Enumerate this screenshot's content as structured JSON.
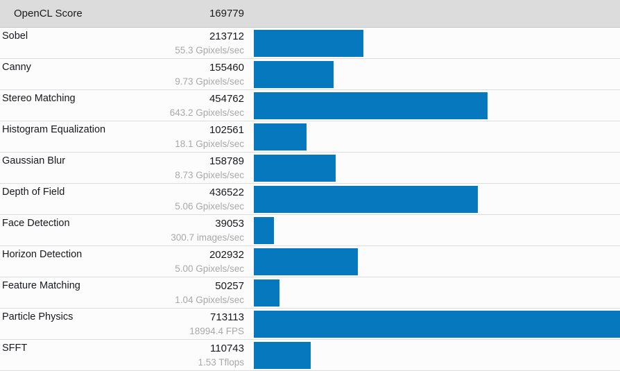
{
  "header": {
    "title": "OpenCL Score",
    "score": "169779"
  },
  "colors": {
    "bar": "#0578be",
    "header_bg": "#dcdcdc",
    "row_bg": "#fcfcfc",
    "separator": "#dcdcdc",
    "score_text": "#16181c",
    "rate_text": "#a8a8a8"
  },
  "chart_data": {
    "type": "bar",
    "title": "OpenCL Score",
    "orientation": "horizontal",
    "xlabel": "",
    "ylabel": "",
    "grid": false,
    "legend": "none",
    "max_value": 713113,
    "overall_score": 169779,
    "categories": [
      "Sobel",
      "Canny",
      "Stereo Matching",
      "Histogram Equalization",
      "Gaussian Blur",
      "Depth of Field",
      "Face Detection",
      "Horizon Detection",
      "Feature Matching",
      "Particle Physics",
      "SFFT"
    ],
    "values": [
      213712,
      155460,
      454762,
      102561,
      158789,
      436522,
      39053,
      202932,
      50257,
      713113,
      110743
    ],
    "rates": [
      "55.3 Gpixels/sec",
      "9.73 Gpixels/sec",
      "643.2 Gpixels/sec",
      "18.1 Gpixels/sec",
      "8.73 Gpixels/sec",
      "5.06 Gpixels/sec",
      "300.7 images/sec",
      "5.00 Gpixels/sec",
      "1.04 Gpixels/sec",
      "18994.4 FPS",
      "1.53 Tflops"
    ]
  },
  "rows": [
    {
      "name": "Sobel",
      "score": "213712",
      "rate": "55.3 Gpixels/sec",
      "value": 213712
    },
    {
      "name": "Canny",
      "score": "155460",
      "rate": "9.73 Gpixels/sec",
      "value": 155460
    },
    {
      "name": "Stereo Matching",
      "score": "454762",
      "rate": "643.2 Gpixels/sec",
      "value": 454762
    },
    {
      "name": "Histogram Equalization",
      "score": "102561",
      "rate": "18.1 Gpixels/sec",
      "value": 102561
    },
    {
      "name": "Gaussian Blur",
      "score": "158789",
      "rate": "8.73 Gpixels/sec",
      "value": 158789
    },
    {
      "name": "Depth of Field",
      "score": "436522",
      "rate": "5.06 Gpixels/sec",
      "value": 436522
    },
    {
      "name": "Face Detection",
      "score": "39053",
      "rate": "300.7 images/sec",
      "value": 39053
    },
    {
      "name": "Horizon Detection",
      "score": "202932",
      "rate": "5.00 Gpixels/sec",
      "value": 202932
    },
    {
      "name": "Feature Matching",
      "score": "50257",
      "rate": "1.04 Gpixels/sec",
      "value": 50257
    },
    {
      "name": "Particle Physics",
      "score": "713113",
      "rate": "18994.4 FPS",
      "value": 713113
    },
    {
      "name": "SFFT",
      "score": "110743",
      "rate": "1.53 Tflops",
      "value": 110743
    }
  ]
}
